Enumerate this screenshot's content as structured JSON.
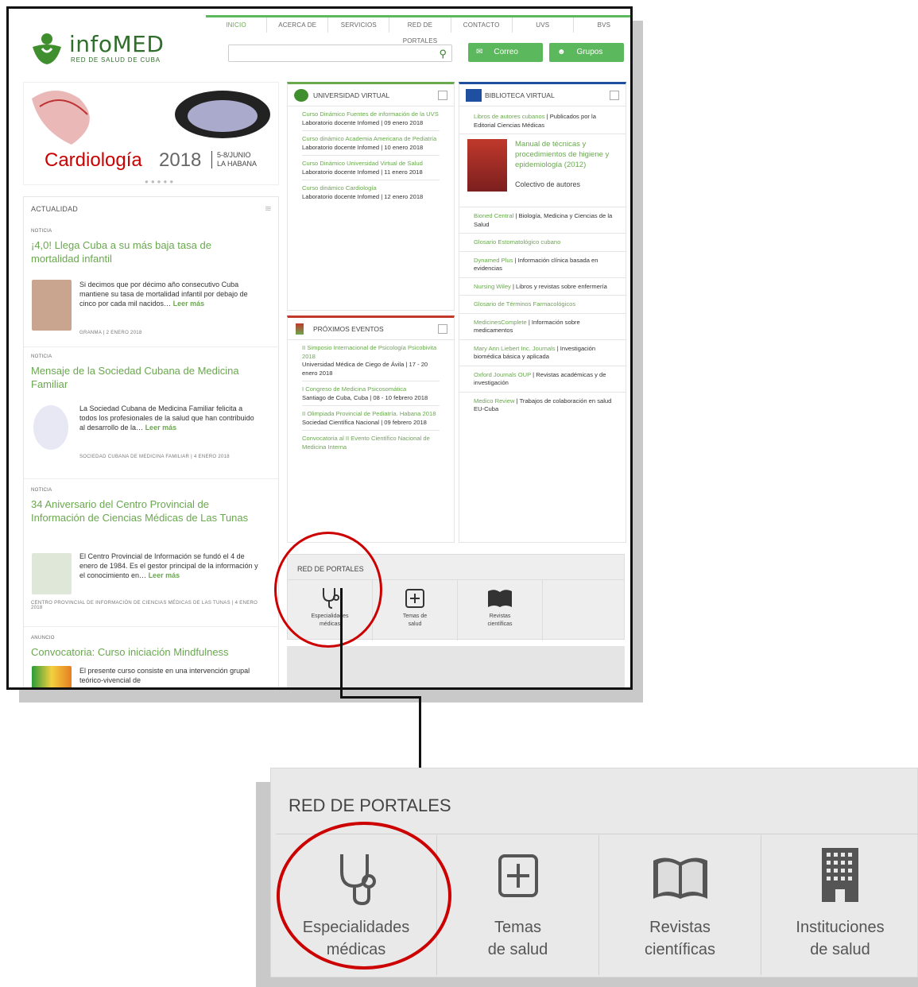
{
  "nav": [
    "INICIO",
    "ACERCA DE",
    "SERVICIOS",
    "RED DE PORTALES",
    "CONTACTO",
    "UVS",
    "BVS"
  ],
  "logo": {
    "name": "infoMED",
    "sub": "RED DE SALUD DE CUBA"
  },
  "header_buttons": {
    "correo": "Correo",
    "grupos": "Grupos"
  },
  "banner": {
    "title": "Cardiología",
    "year": "2018",
    "date": "5-8/JUNIO",
    "place": "LA HABANA"
  },
  "actualidad": {
    "title": "ACTUALIDAD",
    "items": [
      {
        "tag": "NOTICIA",
        "title": "¡4,0! Llega Cuba a su más baja tasa de mortalidad infantil",
        "body": "Si decimos que por décimo año consecutivo Cuba mantiene su tasa de mortalidad infantil por debajo de cinco por cada mil nacidos…",
        "leer": "Leer más",
        "meta": "GRANMA | 2 ENERO 2018"
      },
      {
        "tag": "NOTICIA",
        "title": "Mensaje de la Sociedad Cubana de Medicina Familiar",
        "body": "La Sociedad Cubana de Medicina Familiar felicita a todos los profesionales de la salud que han contribuido al desarrollo de la…",
        "leer": "Leer más",
        "meta": "SOCIEDAD CUBANA DE MEDICINA FAMILIAR | 4 ENERO 2018"
      },
      {
        "tag": "NOTICIA",
        "title": "34 Aniversario del Centro Provincial de Información de Ciencias Médicas de Las Tunas",
        "body": "El Centro Provincial de Información se fundó el 4 de enero de 1984. Es el gestor principal de la información y el conocimiento en…",
        "leer": "Leer más",
        "meta": "CENTRO PROVINCIAL DE INFORMACIÓN DE CIENCIAS MÉDICAS DE LAS TUNAS | 4 ENERO 2018"
      },
      {
        "tag": "ANUNCIO",
        "title": "Convocatoria: Curso iniciación Mindfulness",
        "body": "El presente curso consiste en una intervención grupal teórico-vivencial de"
      }
    ]
  },
  "universidad": {
    "title": "UNIVERSIDAD VIRTUAL",
    "items": [
      {
        "link": "Curso Dinámico Fuentes de información de la UVS",
        "sub": "Laboratorio docente Infomed | 09 enero 2018"
      },
      {
        "link": "Curso dinámico Academia Americana de Pediatría",
        "sub": "Laboratorio docente Infomed | 10 enero 2018"
      },
      {
        "link": "Curso Dinámico Universidad Virtual de Salud",
        "sub": "Laboratorio docente Infomed | 11 enero 2018"
      },
      {
        "link": "Curso dinámico Cardiología",
        "sub": "Laboratorio docente Infomed | 12 enero 2018"
      }
    ]
  },
  "eventos": {
    "title": "PRÓXIMOS EVENTOS",
    "items": [
      {
        "link": "II Simposio Internacional de Psicología Psicobivita 2018",
        "sub": "Universidad Médica de Ciego de Ávila | 17 - 20 enero 2018"
      },
      {
        "link": "I Congreso de Medicina Psicosomática",
        "sub": "Santiago de Cuba, Cuba | 08 - 10 febrero 2018"
      },
      {
        "link": "II Olimpiada Provincial de Pediatría. Habana 2018",
        "sub": "Sociedad Científica Nacional | 09 febrero 2018"
      },
      {
        "link": "Convocatoria al II Evento Científico Nacional de Medicina Interna",
        "sub": ""
      }
    ]
  },
  "biblioteca": {
    "title": "BIBLIOTECA VIRTUAL",
    "items": [
      {
        "link": "Libros de autores cubanos",
        "sub": "| Publicados por la Editorial Ciencias Médicas"
      },
      {
        "link": "Bioned Central",
        "sub": "| Biología, Medicina y Ciencias de la Salud"
      },
      {
        "link": "Glosario Estomatológico cubano",
        "sub": ""
      },
      {
        "link": "Dynamed Plus",
        "sub": "| Información clínica basada en evidencias"
      },
      {
        "link": "Nursing Wiley",
        "sub": "| Libros y revistas sobre enfermería"
      },
      {
        "link": "Glosario de Términos Farmacológicos",
        "sub": ""
      },
      {
        "link": "MedicinesComplete",
        "sub": "| Información sobre medicamentos"
      },
      {
        "link": "Mary Ann Liebert Inc. Journals",
        "sub": "| Investigación biomédica básica y aplicada"
      },
      {
        "link": "Oxford Journals OUP",
        "sub": "| Revistas académicas y de investigación"
      },
      {
        "link": "Medico Review",
        "sub": "| Trabajos de colaboración en salud EU-Cuba"
      }
    ],
    "book": {
      "title": "Manual de técnicas y procedimientos de higiene y epidemiología (2012)",
      "author": "Colectivo de autores"
    }
  },
  "red_small": {
    "title": "RED DE PORTALES",
    "cells": [
      {
        "l1": "Especialidades",
        "l2": "médicas"
      },
      {
        "l1": "Temas de",
        "l2": "salud"
      },
      {
        "l1": "Revistas",
        "l2": "científicas"
      }
    ]
  },
  "red_zoom": {
    "title": "RED DE PORTALES",
    "cells": [
      {
        "l1": "Especialidades",
        "l2": "médicas"
      },
      {
        "l1": "Temas",
        "l2": "de salud"
      },
      {
        "l1": "Revistas",
        "l2": "científicas"
      },
      {
        "l1": "Instituciones",
        "l2": "de salud"
      }
    ]
  },
  "colors": {
    "green": "#6aa84f",
    "blue": "#1e4fa0",
    "red_circle": "#cc0000",
    "dark_green": "#2f6e2b"
  }
}
